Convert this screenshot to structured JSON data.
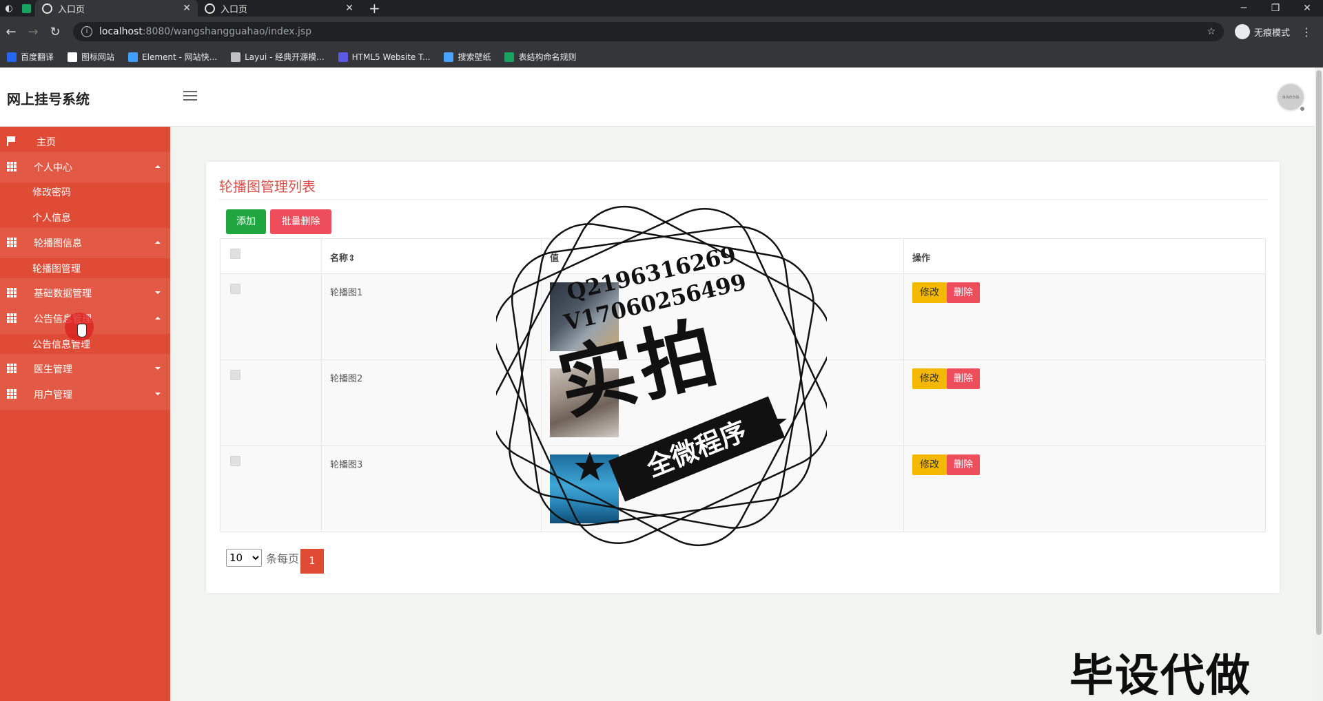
{
  "browser": {
    "tabs": [
      {
        "label": "入口页"
      },
      {
        "label": "入口页"
      }
    ],
    "url_host": "localhost",
    "url_path": ":8080/wangshangguahao/index.jsp",
    "incognito_label": "无痕模式",
    "bookmarks": [
      {
        "label": "百度翻译",
        "color": "#2468f2"
      },
      {
        "label": "图标网站",
        "color": "#ffffff"
      },
      {
        "label": "Element - 网站快...",
        "color": "#409eff"
      },
      {
        "label": "Layui - 经典开源模...",
        "color": "#c0c0c0"
      },
      {
        "label": "HTML5 Website T...",
        "color": "#5a5ae6"
      },
      {
        "label": "搜索壁纸",
        "color": "#4aa3ff"
      },
      {
        "label": "表结构命名规则",
        "color": "#1aa260"
      }
    ]
  },
  "header": {
    "app_title": "网上挂号系统",
    "avatar_text": "aaaaa"
  },
  "sidebar": {
    "items": [
      {
        "label": "主页",
        "type": "home"
      },
      {
        "label": "个人中心",
        "type": "group",
        "expanded": true
      },
      {
        "label": "修改密码",
        "type": "sub"
      },
      {
        "label": "个人信息",
        "type": "sub"
      },
      {
        "label": "轮播图信息",
        "type": "group",
        "expanded": true
      },
      {
        "label": "轮播图管理",
        "type": "sub"
      },
      {
        "label": "基础数据管理",
        "type": "group",
        "expanded": false
      },
      {
        "label": "公告信息管理",
        "type": "group",
        "expanded": true
      },
      {
        "label": "公告信息管理",
        "type": "sub"
      },
      {
        "label": "医生管理",
        "type": "group",
        "expanded": false
      },
      {
        "label": "用户管理",
        "type": "group",
        "expanded": false
      }
    ]
  },
  "main": {
    "title": "轮播图管理列表",
    "add_label": "添加",
    "batch_delete_label": "批量删除",
    "columns": [
      "名称",
      "值",
      "操作"
    ],
    "rows": [
      {
        "name": "轮播图1"
      },
      {
        "name": "轮播图2"
      },
      {
        "name": "轮播图3"
      }
    ],
    "edit_label": "修改",
    "delete_label": "删除",
    "page_size": "10",
    "page_size_suffix": "条每页",
    "current_page": "1"
  },
  "watermark": {
    "contact_q": "Q2196316269",
    "contact_v": "V1706025649​9",
    "big_text": "实拍",
    "band_text": "全微程序",
    "bottom_text": "毕设代做"
  },
  "colors": {
    "sidebar": "#e04b36",
    "accent_title": "#d9534f",
    "add_button": "#1fa63f",
    "delete_button": "#ee4d5c",
    "edit_button": "#f5b800"
  }
}
